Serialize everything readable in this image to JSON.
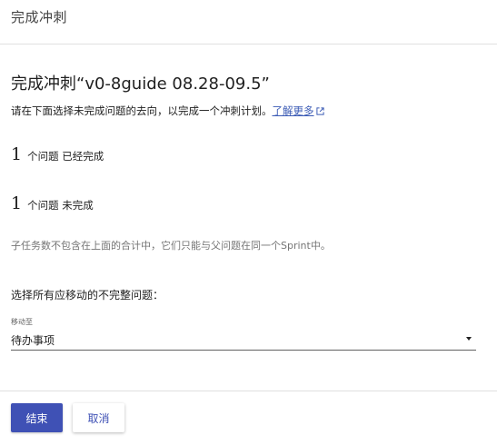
{
  "header": {
    "title": "完成冲刺"
  },
  "main": {
    "title": "完成冲刺“v0-8guide 08.28-09.5”",
    "description": "请在下面选择未完成问题的去向，以完成一个冲刺计划。",
    "learn_more": "了解更多",
    "completed": {
      "count": "1",
      "label": "个问题 已经完成"
    },
    "incomplete": {
      "count": "1",
      "label": "个问题 未完成"
    },
    "note": "子任务数不包含在上面的合计中，它们只能与父问题在同一个Sprint中。",
    "question": "选择所有应移动的不完整问题：",
    "move_to": {
      "label": "移动至",
      "value": "待办事项"
    }
  },
  "footer": {
    "confirm_label": "结束",
    "cancel_label": "取消"
  },
  "colors": {
    "primary": "#3f51b5",
    "link": "#3b5bb5",
    "divider": "#e0e0e0"
  },
  "icons": {
    "external_link": "external-link-icon",
    "dropdown": "dropdown-arrow-icon"
  }
}
